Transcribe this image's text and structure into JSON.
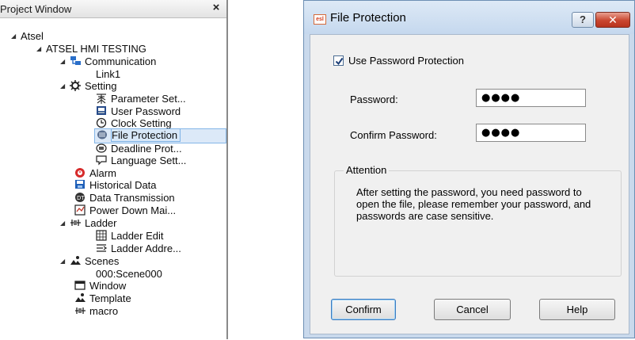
{
  "project_window": {
    "title": "Project Window",
    "close_glyph": "×",
    "tree": [
      {
        "label": "Atsel",
        "icon": "none",
        "expander": true
      },
      {
        "label": "ATSEL HMI TESTING",
        "icon": "none",
        "expander": true
      },
      {
        "label": "Communication",
        "icon": "network-icon",
        "expander": true
      },
      {
        "label": "Link1",
        "icon": "none",
        "expander": false
      },
      {
        "label": "Setting",
        "icon": "gear-icon",
        "expander": true
      },
      {
        "label": "Parameter Set...",
        "icon": "parameter-icon",
        "expander": false
      },
      {
        "label": "User Password",
        "icon": "user-password-icon",
        "expander": false
      },
      {
        "label": "Clock Setting",
        "icon": "clock-icon",
        "expander": false
      },
      {
        "label": "File Protection",
        "icon": "file-protection-icon",
        "expander": false,
        "selected": true
      },
      {
        "label": "Deadline Prot...",
        "icon": "deadline-icon",
        "expander": false
      },
      {
        "label": "Language Sett...",
        "icon": "language-icon",
        "expander": false
      },
      {
        "label": "Alarm",
        "icon": "alarm-icon",
        "expander": false
      },
      {
        "label": "Historical Data",
        "icon": "historical-data-icon",
        "expander": false
      },
      {
        "label": "Data Transmission",
        "icon": "data-transmission-icon",
        "expander": false
      },
      {
        "label": "Power Down Mai...",
        "icon": "power-down-icon",
        "expander": false
      },
      {
        "label": "Ladder",
        "icon": "ladder-icon",
        "expander": true
      },
      {
        "label": "Ladder Edit",
        "icon": "ladder-edit-icon",
        "expander": false
      },
      {
        "label": "Ladder Addre...",
        "icon": "ladder-address-icon",
        "expander": false
      },
      {
        "label": "Scenes",
        "icon": "scenes-icon",
        "expander": true
      },
      {
        "label": "000:Scene000",
        "icon": "none",
        "expander": false
      },
      {
        "label": "Window",
        "icon": "window-icon",
        "expander": false
      },
      {
        "label": "Template",
        "icon": "template-icon",
        "expander": false
      },
      {
        "label": "macro",
        "icon": "macro-icon",
        "expander": false
      }
    ]
  },
  "dialog": {
    "title": "File Protection",
    "help_glyph": "?",
    "close_glyph": "✕",
    "use_password": {
      "label": "Use Password Protection",
      "checked": true
    },
    "password": {
      "label": "Password:",
      "value": "●●●●"
    },
    "confirm_password": {
      "label": "Confirm Password:",
      "value": "●●●●"
    },
    "attention": {
      "title": "Attention",
      "text": "After setting the password, you need password to open the file, please remember your password, and passwords are case sensitive."
    },
    "buttons": {
      "confirm": "Confirm",
      "cancel": "Cancel",
      "help": "Help"
    }
  }
}
